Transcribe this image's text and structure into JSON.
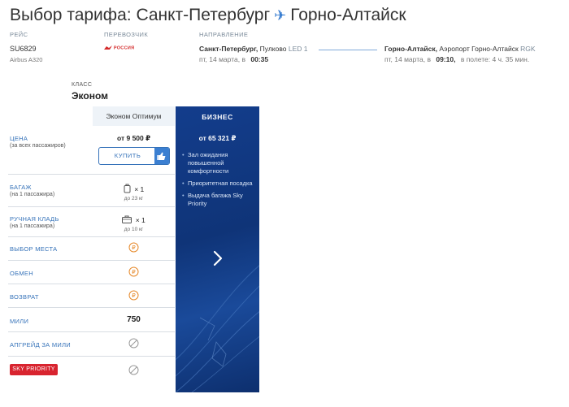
{
  "header": {
    "origin": "Санкт-Петербург",
    "destination": "Горно-Алтайск",
    "title_prefix": "Выбор тарифа:"
  },
  "flight": {
    "col_flight_label": "Рейс",
    "col_carrier_label": "Перевозчик",
    "col_direction_label": "Направление",
    "number": "SU6829",
    "aircraft": "Airbus A320",
    "carrier_logo_text": "РОССИЯ",
    "departure": {
      "city": "Санкт-Петербург,",
      "airport": "Пулково",
      "code": "LED 1",
      "date": "пт, 14 марта, в",
      "time": "00:35"
    },
    "arrival": {
      "city": "Горно-Алтайск,",
      "airport": "Аэропорт Горно-Алтайск",
      "code": "RGK",
      "date": "пт, 14 марта, в",
      "time": "09:10,",
      "duration": "в полете: 4 ч. 35 мин."
    }
  },
  "class": {
    "label": "Класс",
    "value": "Эконом"
  },
  "economy": {
    "tariff_name": "Эконом Оптимум",
    "price": "от 9 500 ₽",
    "buy_label": "Купить",
    "baggage_count": "× 1",
    "baggage_weight": "до 23 кг",
    "hand_count": "× 1",
    "hand_weight": "до 10 кг",
    "miles": "750"
  },
  "business": {
    "title": "Бизнес",
    "price": "от 65 321 ₽",
    "features": [
      "Зал ожидания повышенной комфортности",
      "Приоритетная посадка",
      "Выдача багажа Sky Priority"
    ]
  },
  "rows": {
    "price": {
      "label": "Цена",
      "sub": "(за всех пассажиров)"
    },
    "baggage": {
      "label": "Багаж",
      "sub": "(на 1 пассажира)"
    },
    "hand": {
      "label": "Ручная кладь",
      "sub": "(на 1 пассажира)"
    },
    "seat": {
      "label": "Выбор места"
    },
    "exchange": {
      "label": "Обмен"
    },
    "refund": {
      "label": "Возврат"
    },
    "miles": {
      "label": "Мили"
    },
    "upgrade": {
      "label": "Апгрейд за мили"
    },
    "sky_priority": {
      "label": "SKY PRIORITY"
    }
  },
  "colors": {
    "accent_blue": "#3572b9",
    "business_bg": "#0f3478",
    "fee_orange": "#e6892a",
    "sky_red": "#d8242f"
  },
  "icons": {
    "plane": "airplane-icon",
    "thumb": "thumbs-up-icon",
    "baggage": "suitcase-icon",
    "hand": "briefcase-icon",
    "fee": "ruble-coin-icon",
    "unavailable": "not-available-icon",
    "next": "chevron-right-icon"
  }
}
